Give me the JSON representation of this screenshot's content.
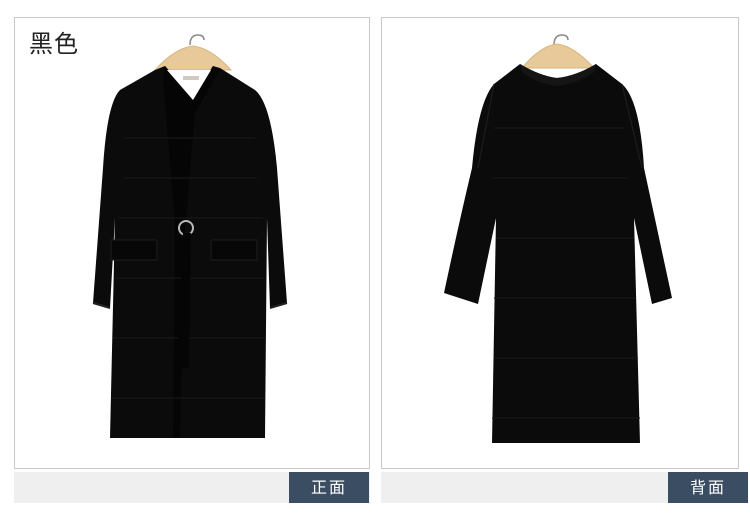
{
  "color_label": "黑色",
  "front_tab": "正面",
  "back_tab": "背面",
  "colors": {
    "garment": "#0b0b0b",
    "hanger": "#e8c99a",
    "tab_bg": "#3b4d62",
    "tab_text": "#ffffff",
    "strip_bg": "#efefef",
    "border": "#c9c9c9"
  }
}
